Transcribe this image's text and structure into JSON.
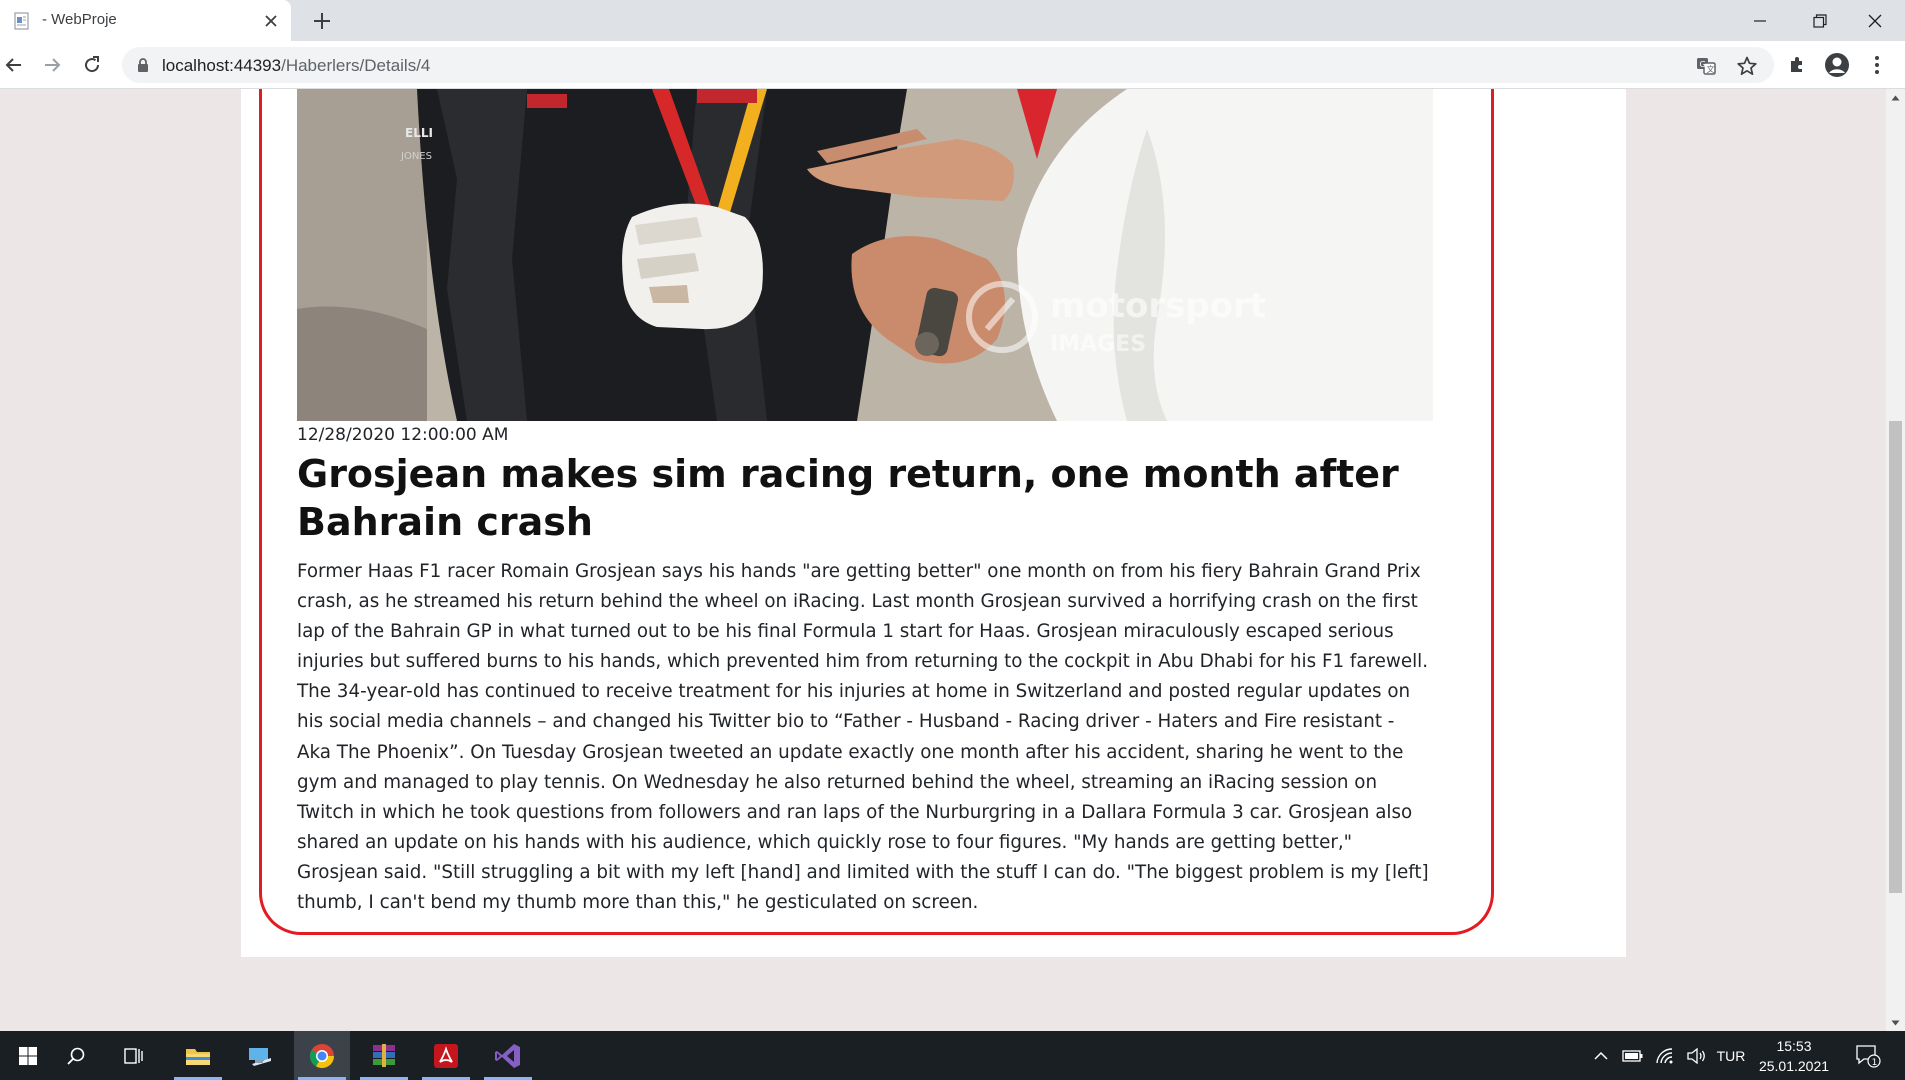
{
  "browser": {
    "tab_title": "- WebProje",
    "url_host": "localhost:44393",
    "url_path": "/Haberlers/Details/4"
  },
  "article": {
    "date": "12/28/2020 12:00:00 AM",
    "title": "Grosjean makes sim racing return, one month after Bahrain crash",
    "image_watermark": "motorsport",
    "image_watermark_sub": "IMAGES",
    "body": "Former Haas F1 racer Romain Grosjean says his hands \"are getting better\" one month on from his fiery Bahrain Grand Prix crash, as he streamed his return behind the wheel on iRacing. Last month Grosjean survived a horrifying crash on the first lap of the Bahrain GP in what turned out to be his final Formula 1 start for Haas. Grosjean miraculously escaped serious injuries but suffered burns to his hands, which prevented him from returning to the cockpit in Abu Dhabi for his F1 farewell. The 34-year-old has continued to receive treatment for his injuries at home in Switzerland and posted regular updates on his social media channels – and changed his Twitter bio to “Father - Husband - Racing driver - Haters and Fire resistant - Aka The Phoenix”. On Tuesday Grosjean tweeted an update exactly one month after his accident, sharing he went to the gym and managed to play tennis. On Wednesday he also returned behind the wheel, streaming an iRacing session on Twitch in which he took questions from followers and ran laps of the Nurburgring in a Dallara Formula 3 car. Grosjean also shared an update on his hands with his audience, which quickly rose to four figures. \"My hands are getting better,\" Grosjean said. \"Still struggling a bit with my left [hand] and limited with the stuff I can do. \"The biggest problem is my [left] thumb, I can't bend my thumb more than this,\" he gesticulated on screen."
  },
  "taskbar": {
    "language": "TUR",
    "time": "15:53",
    "date": "25.01.2021",
    "notification_count": "1"
  },
  "colors": {
    "card_border": "#e31b23",
    "page_background": "#ece6e6",
    "taskbar": "#1a1f24"
  }
}
